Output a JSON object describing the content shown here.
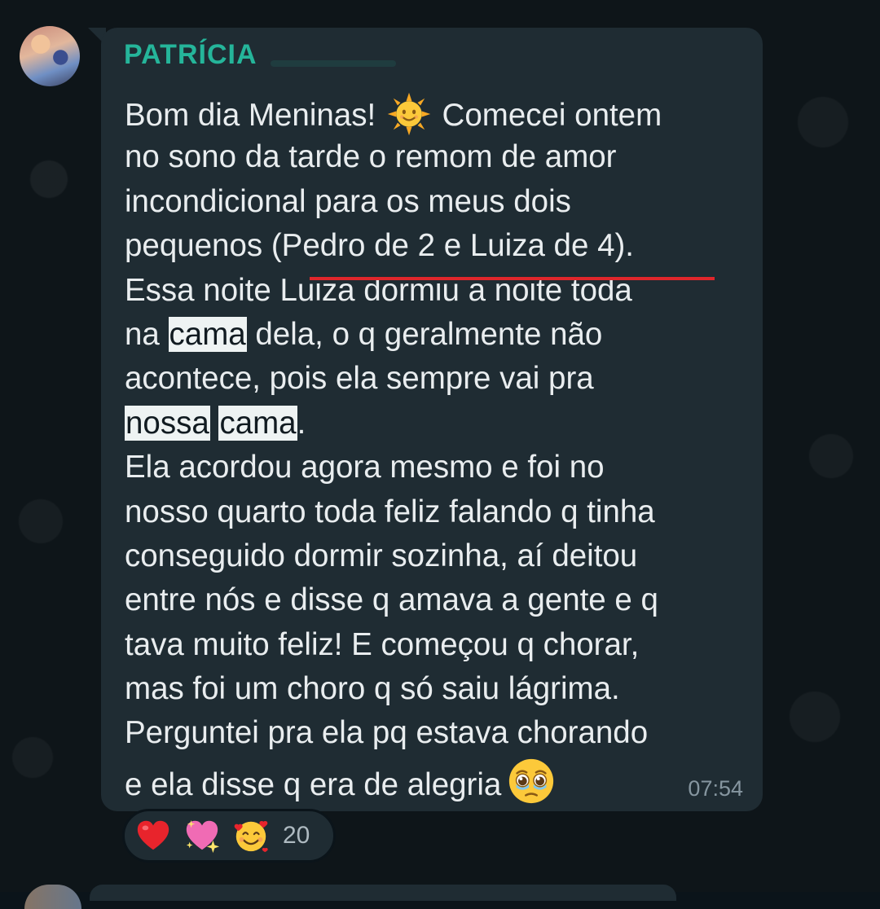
{
  "chat": {
    "sender_name": "PATRÍCIA",
    "message_lines": {
      "l1a": "Bom dia Meninas! ",
      "l1b": " Comecei ontem",
      "l2": "no sono da tarde o remom de amor",
      "l3": "incondicional para os meus dois",
      "l4": "pequenos (Pedro de 2 e Luiza de 4).",
      "l5": "Essa noite Luiza dormiu a noite toda",
      "l6a": "na ",
      "l6b": "cama",
      "l6c": " dela, o q geralmente não",
      "l7": "acontece, pois ela sempre vai pra",
      "l8a": "nossa",
      "l8b": " ",
      "l8c": "cama",
      "l8d": ".",
      "l9": "Ela acordou agora mesmo e foi no",
      "l10": "nosso quarto toda feliz falando q tinha",
      "l11": "conseguido dormir sozinha, aí deitou",
      "l12": "entre nós e disse q amava a gente e q",
      "l13": "tava muito feliz! E começou q chorar,",
      "l14": "mas foi um choro q só saiu lágrima.",
      "l15": "Perguntei pra ela pq estava chorando",
      "l16": "e ela disse q era de alegria"
    },
    "inline_emojis": [
      "sun-with-face",
      "face-holding-back-tears"
    ],
    "timestamp": "07:54",
    "reactions": {
      "emojis": [
        "red-heart",
        "sparkling-heart",
        "smiling-face-with-hearts"
      ],
      "count": "20"
    }
  }
}
